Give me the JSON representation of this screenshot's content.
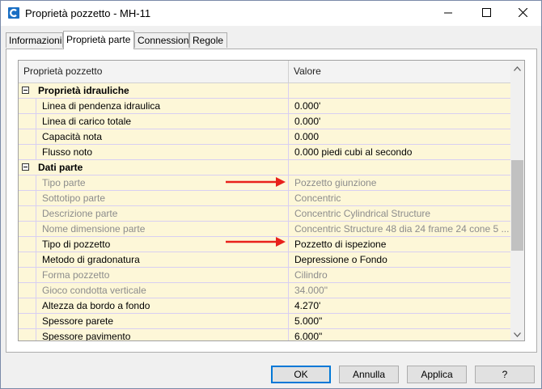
{
  "window": {
    "title": "Proprietà pozzetto - MH-11",
    "icon": "civil3d-app-icon"
  },
  "tabs": [
    {
      "label": "Informazioni",
      "active": false
    },
    {
      "label": "Proprietà parte",
      "active": true
    },
    {
      "label": "Connessioni",
      "active": false
    },
    {
      "label": "Regole",
      "active": false
    }
  ],
  "grid": {
    "col1_header": "Proprietà pozzetto",
    "col2_header": "Valore",
    "rows": [
      {
        "type": "category",
        "name": "Proprietà idrauliche",
        "value": ""
      },
      {
        "type": "prop",
        "name": "Linea di pendenza idraulica",
        "value": "0.000'",
        "disabled": false
      },
      {
        "type": "prop",
        "name": "Linea di carico totale",
        "value": "0.000'",
        "disabled": false
      },
      {
        "type": "prop",
        "name": "Capacità nota",
        "value": "0.000",
        "disabled": false
      },
      {
        "type": "prop",
        "name": "Flusso noto",
        "value": "0.000 piedi cubi al secondo",
        "disabled": false
      },
      {
        "type": "category",
        "name": "Dati parte",
        "value": ""
      },
      {
        "type": "prop",
        "name": "Tipo parte",
        "value": "Pozzetto giunzione",
        "disabled": true
      },
      {
        "type": "prop",
        "name": "Sottotipo parte",
        "value": "Concentric",
        "disabled": true
      },
      {
        "type": "prop",
        "name": "Descrizione parte",
        "value": "Concentric Cylindrical Structure",
        "disabled": true
      },
      {
        "type": "prop",
        "name": "Nome dimensione parte",
        "value": "Concentric Structure 48 dia 24 frame 24 cone 5 ...",
        "disabled": true
      },
      {
        "type": "prop",
        "name": "Tipo di pozzetto",
        "value": "Pozzetto di ispezione",
        "disabled": false
      },
      {
        "type": "prop",
        "name": "Metodo di gradonatura",
        "value": "Depressione o Fondo",
        "disabled": false
      },
      {
        "type": "prop",
        "name": "Forma pozzetto",
        "value": "Cilindro",
        "disabled": true
      },
      {
        "type": "prop",
        "name": "Gioco condotta verticale",
        "value": "34.000\"",
        "disabled": true
      },
      {
        "type": "prop",
        "name": "Altezza da bordo a fondo",
        "value": "4.270'",
        "disabled": false
      },
      {
        "type": "prop",
        "name": "Spessore parete",
        "value": "5.000\"",
        "disabled": false
      },
      {
        "type": "prop",
        "name": "Spessore pavimento",
        "value": "6.000\"",
        "disabled": false
      }
    ]
  },
  "buttons": {
    "ok": "OK",
    "cancel": "Annulla",
    "apply": "Applica",
    "help": "?"
  },
  "colors": {
    "annotation_arrow": "#e8211b",
    "row_background": "#fdf7d8",
    "grid_line": "#d8cff2"
  }
}
